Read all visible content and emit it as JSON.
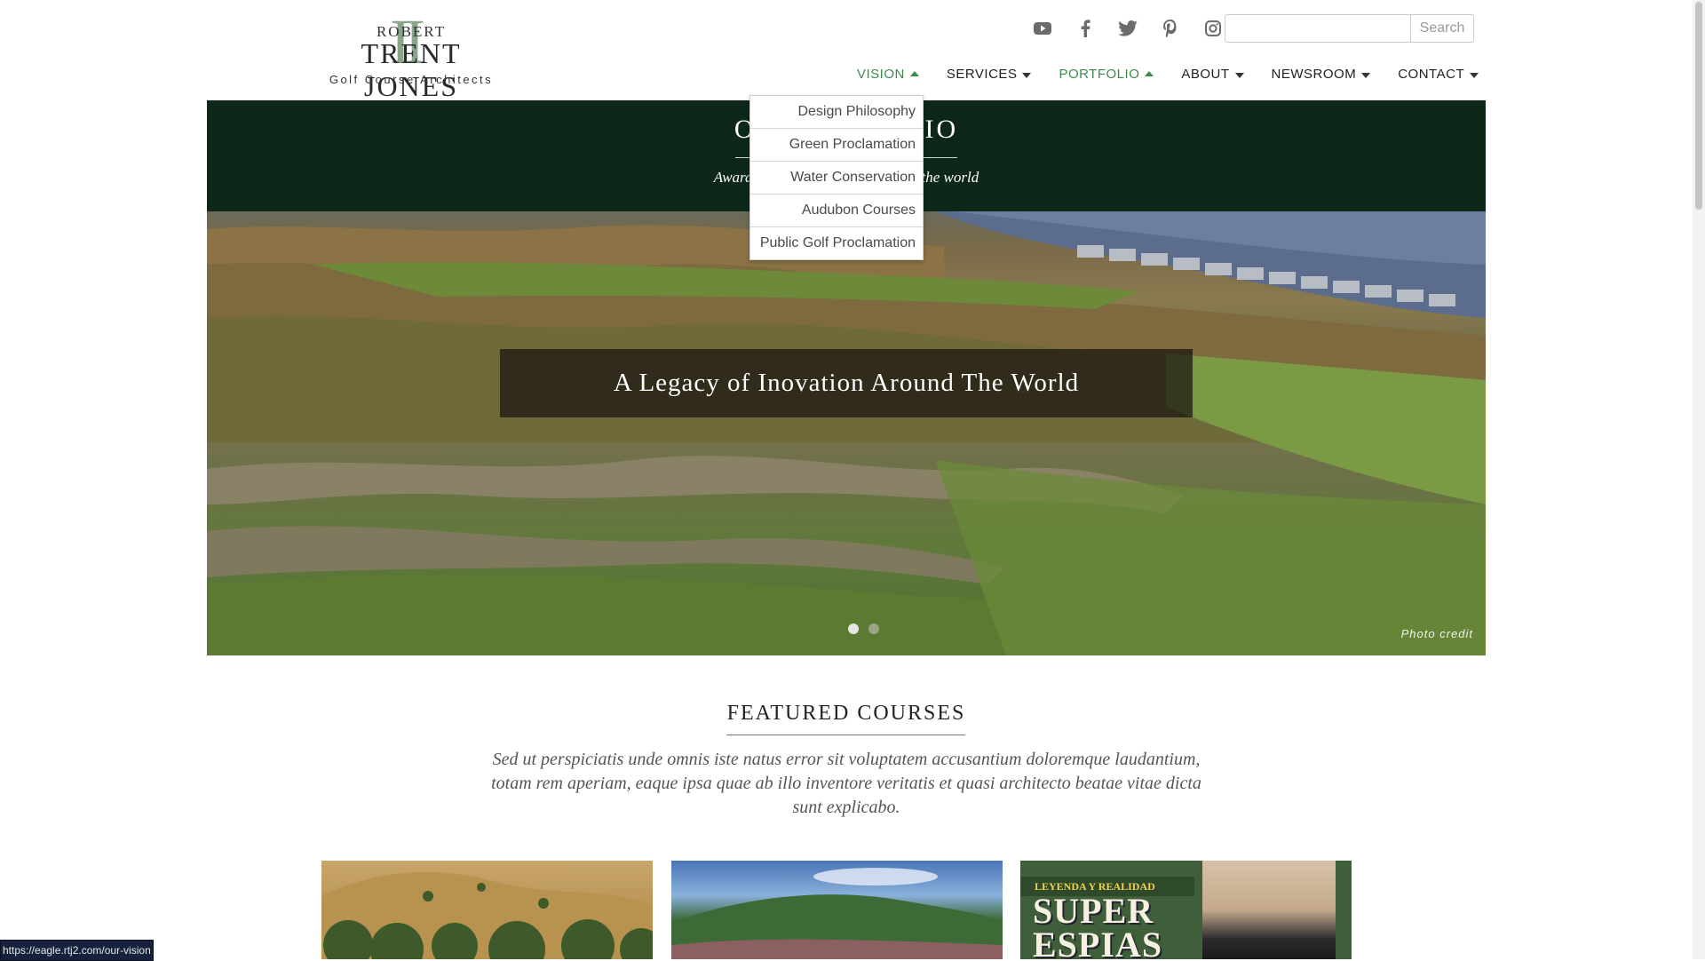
{
  "logo": {
    "monogram": "II",
    "line1": "ROBERT",
    "line2": "TRENT JONES",
    "tagline": "Golf Course Architects"
  },
  "social": [
    {
      "icon": "youtube-icon"
    },
    {
      "icon": "facebook-icon"
    },
    {
      "icon": "twitter-icon"
    },
    {
      "icon": "pinterest-icon"
    },
    {
      "icon": "instagram-icon"
    }
  ],
  "search": {
    "placeholder": "",
    "value": "",
    "button": "Search"
  },
  "nav": [
    {
      "label": "VISION",
      "state": "open",
      "color": "#3e8a4e"
    },
    {
      "label": "SERVICES"
    },
    {
      "label": "PORTFOLIO",
      "state": "active",
      "color": "#3e8a4e"
    },
    {
      "label": "ABOUT"
    },
    {
      "label": "NEWSROOM"
    },
    {
      "label": "CONTACT"
    }
  ],
  "dropdown": {
    "items": [
      "Design Philosophy",
      "Green Proclamation",
      "Water Conservation",
      "Audubon Courses",
      "Public Golf Proclamation"
    ]
  },
  "band": {
    "title_visible_left": "O",
    "title_visible_right": "IO",
    "subtitle_visible_left": "Award",
    "subtitle_visible_right": "the world",
    "bg_color": "#0d2818"
  },
  "hero": {
    "caption": "A Legacy of Inovation Around The World",
    "photo_credit": "Photo credit",
    "slides_total": 2,
    "slide_active": 1
  },
  "featured": {
    "title": "FEATURED COURSES",
    "text": "Sed ut perspiciatis unde omnis iste natus error sit voluptatem accusantium doloremque laudantium, totam rem aperiam, eaque ipsa quae ab illo inventore veritatis et quasi architecto beatae vitae dicta sunt explicabo.",
    "card3_banner": "LEYENDA Y REALIDAD",
    "card3_headline_1": "SUPER",
    "card3_headline_2": "ESPIAS"
  },
  "status_url": "https://eagle.rtj2.com/our-vision"
}
